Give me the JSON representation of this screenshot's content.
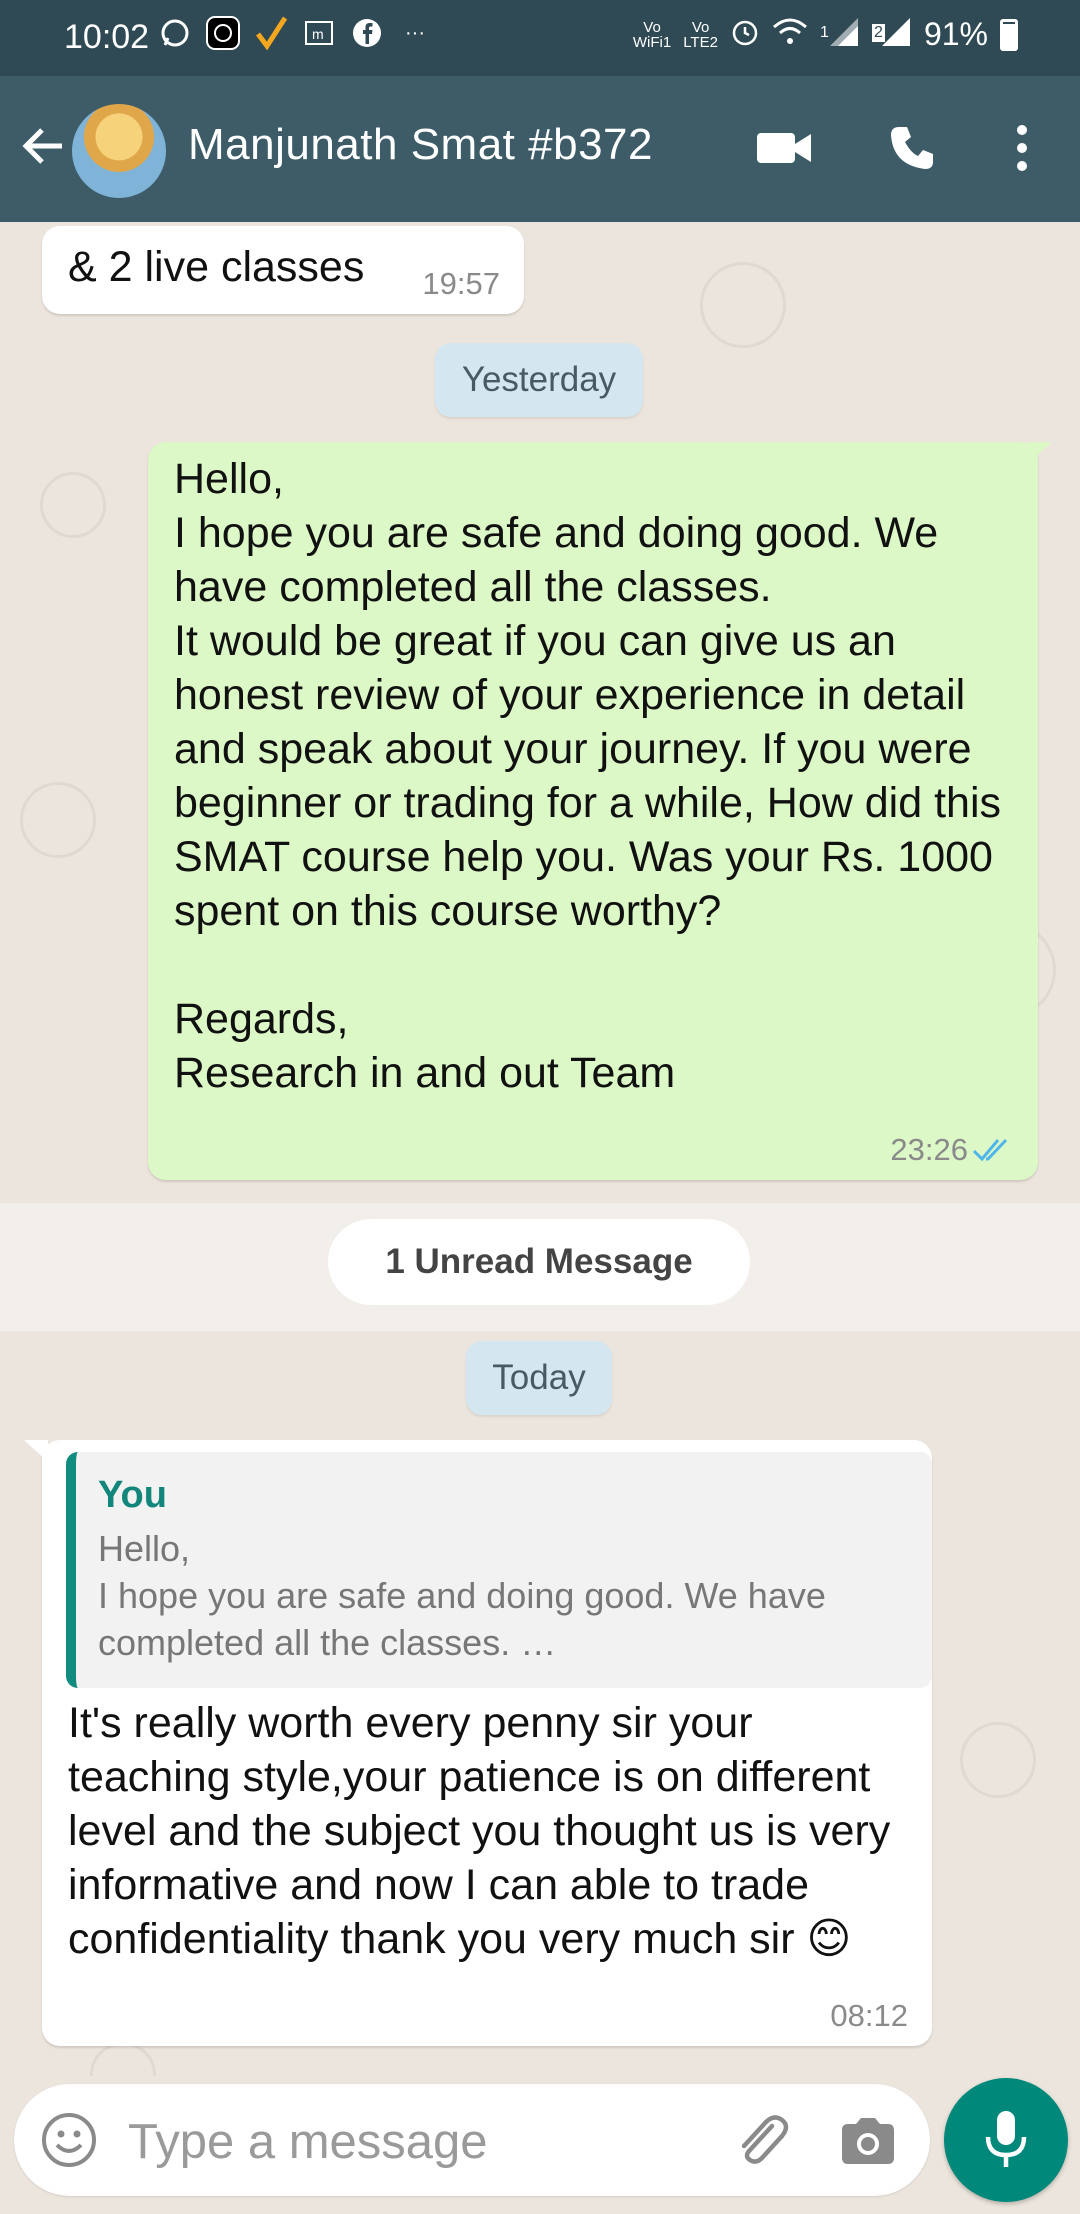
{
  "status_bar": {
    "time": "10:02",
    "wifi_label": "Vo\nWiFi1",
    "lte_label": "Vo\nLTE2",
    "sim1": "1",
    "sim2": "2",
    "battery": "91%"
  },
  "header": {
    "contact_name": "Manjunath Smat #b372",
    "background_color": "#3d5c68"
  },
  "chat": {
    "messages": [
      {
        "type": "incoming",
        "text": "& 2 live classes",
        "time": "19:57"
      },
      {
        "type": "outgoing",
        "text": "Hello,\nI hope you are safe and doing good. We have completed all the classes.\nIt would be great if you can give us an honest review of your experience in detail and speak about your journey. If you were beginner or trading for a while, How did this SMAT course help you. Was your Rs. 1000 spent on this course worthy?\n\nRegards,\nResearch in and out Team",
        "time": "23:26",
        "status": "read"
      },
      {
        "type": "incoming",
        "quote_author": "You",
        "quote_text": "Hello,\nI hope you are safe and doing good. We have completed all the classes. …",
        "text": "It's really worth every penny sir your teaching style,your patience is on different level and the subject you thought us is very informative and now I can able to trade confidentiality thank you very much sir 😊",
        "time": "08:12"
      }
    ],
    "date_separators": [
      "Yesterday",
      "Today"
    ],
    "unread_banner": "1 Unread Message"
  },
  "input": {
    "placeholder": "Type a message"
  },
  "icons": [
    "back-arrow-icon",
    "video-call-icon",
    "phone-icon",
    "more-vert-icon",
    "emoji-icon",
    "attach-icon",
    "camera-icon",
    "mic-icon",
    "read-ticks-icon"
  ],
  "colors": {
    "accent": "#00897b",
    "outgoing_bubble": "#dcf8c6",
    "read_ticks": "#4fb6ec"
  }
}
